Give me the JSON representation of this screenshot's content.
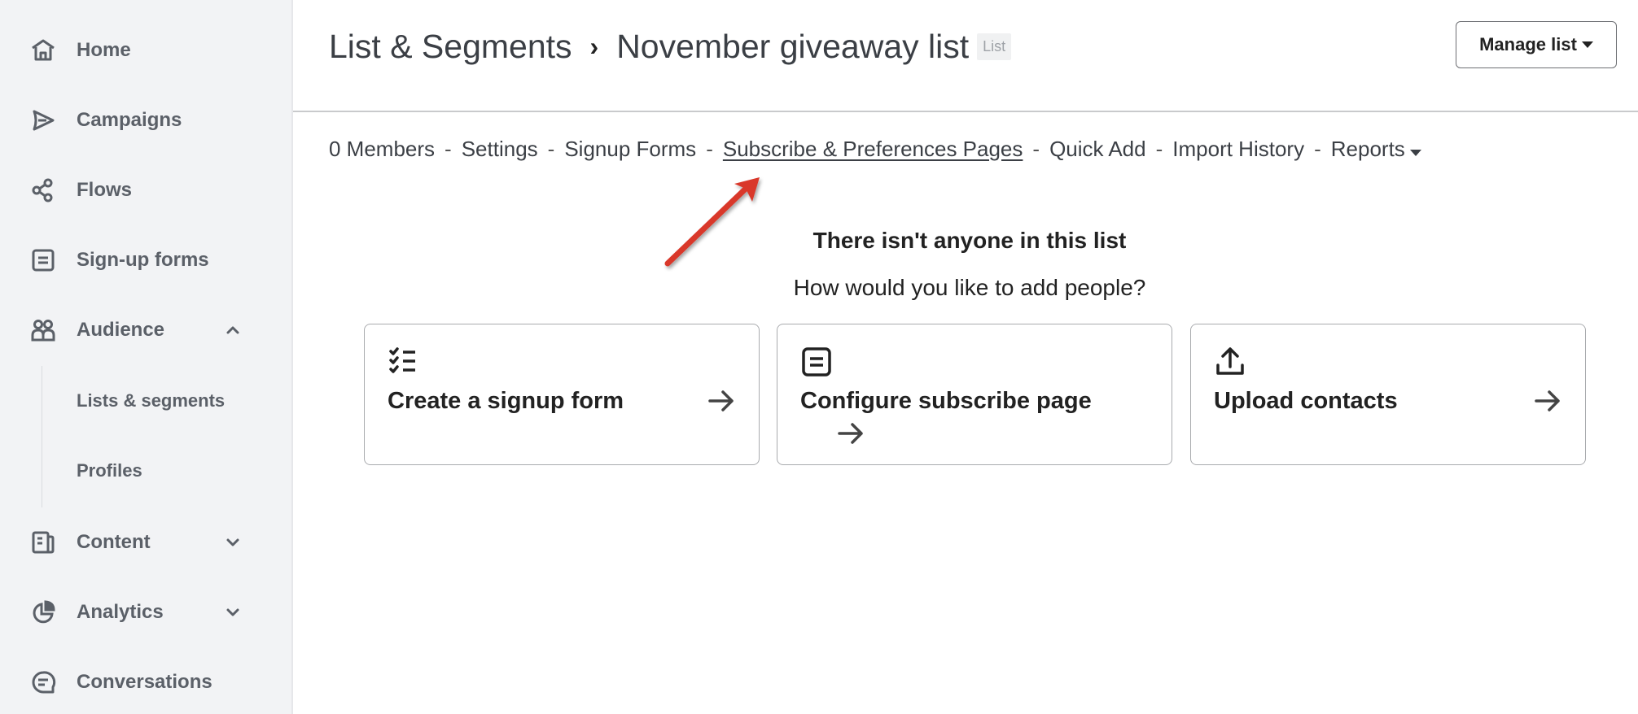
{
  "sidebar": {
    "items": [
      {
        "label": "Home",
        "icon": "home-icon"
      },
      {
        "label": "Campaigns",
        "icon": "send-icon"
      },
      {
        "label": "Flows",
        "icon": "flows-icon"
      },
      {
        "label": "Sign-up forms",
        "icon": "form-icon"
      },
      {
        "label": "Audience",
        "icon": "people-icon",
        "expanded": true
      },
      {
        "label": "Content",
        "icon": "content-icon",
        "expanded": false
      },
      {
        "label": "Analytics",
        "icon": "analytics-icon",
        "expanded": false
      },
      {
        "label": "Conversations",
        "icon": "chat-icon"
      }
    ],
    "audience_subitems": [
      {
        "label": "Lists & segments"
      },
      {
        "label": "Profiles"
      }
    ]
  },
  "header": {
    "breadcrumb_root": "List & Segments",
    "breadcrumb_separator": "›",
    "title": "November giveaway list",
    "badge": "List",
    "manage_button": "Manage list"
  },
  "subnav": {
    "items": [
      {
        "label": "0 Members"
      },
      {
        "label": "Settings"
      },
      {
        "label": "Signup Forms"
      },
      {
        "label": "Subscribe & Preferences Pages",
        "active": true
      },
      {
        "label": "Quick Add"
      },
      {
        "label": "Import History"
      },
      {
        "label": "Reports",
        "dropdown": true
      }
    ],
    "separator": "-"
  },
  "annotation": {
    "color": "#d9382c",
    "target": "Subscribe & Preferences Pages"
  },
  "empty_state": {
    "title": "There isn't anyone in this list",
    "subtitle": "How would you like to add people?",
    "cards": [
      {
        "label": "Create a signup form",
        "icon": "checklist-icon"
      },
      {
        "label": "Configure subscribe page",
        "icon": "form-icon"
      },
      {
        "label": "Upload contacts",
        "icon": "upload-icon"
      }
    ]
  }
}
